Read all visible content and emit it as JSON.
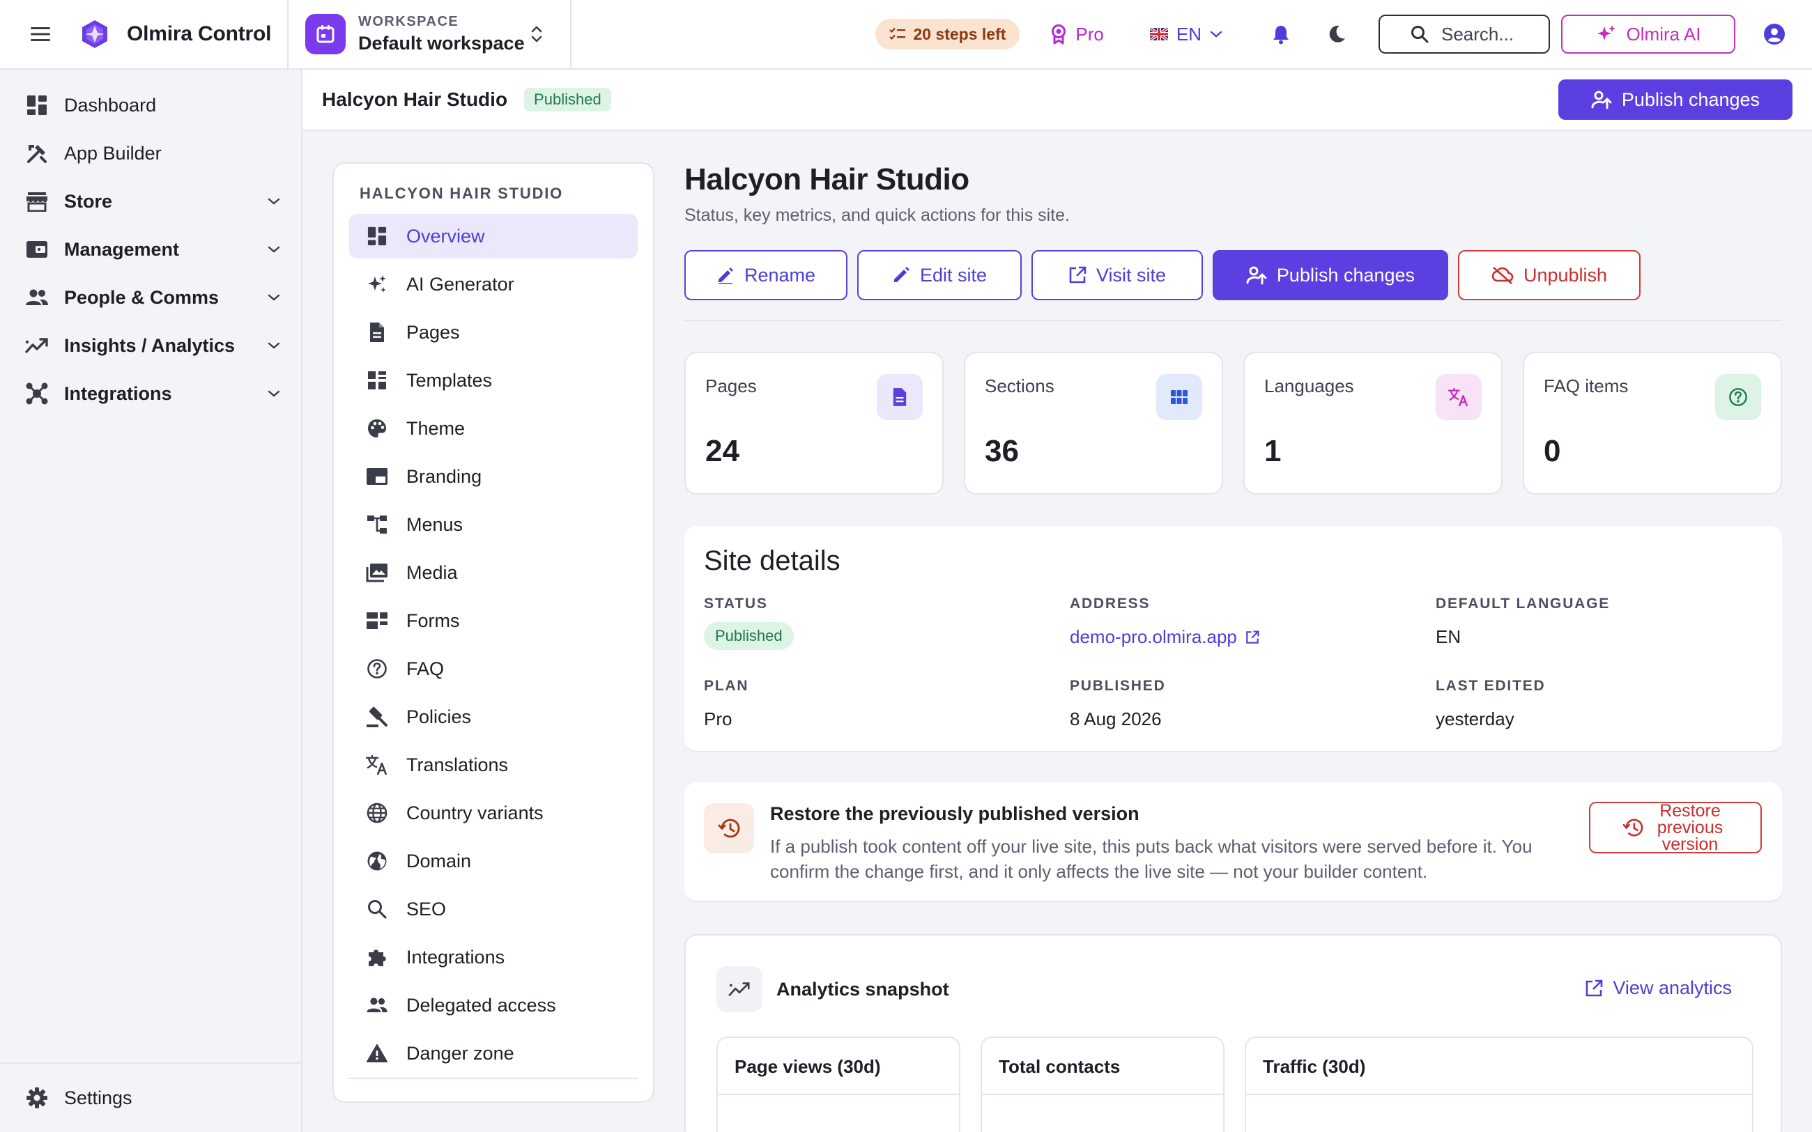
{
  "app": {
    "name": "Olmira Control",
    "workspace_kicker": "WORKSPACE",
    "workspace_name": "Default workspace",
    "steps_left": "20 steps left",
    "plan_label": "Pro",
    "language": "EN",
    "search_placeholder": "Search...",
    "ai_label": "Olmira AI"
  },
  "sidebar": {
    "items": [
      {
        "label": "Dashboard",
        "icon": "dashboard-icon"
      },
      {
        "label": "App Builder",
        "icon": "build-icon"
      },
      {
        "label": "Store",
        "icon": "store-icon"
      },
      {
        "label": "Management",
        "icon": "wallet-icon"
      },
      {
        "label": "People & Comms",
        "icon": "people-icon"
      },
      {
        "label": "Insights / Analytics",
        "icon": "trend-icon"
      },
      {
        "label": "Integrations",
        "icon": "hub-icon"
      }
    ],
    "settings_label": "Settings"
  },
  "header": {
    "site_name": "Halcyon Hair Studio",
    "status_badge": "Published",
    "publish_label": "Publish changes"
  },
  "subnav": {
    "kicker": "HALCYON HAIR STUDIO",
    "items": [
      {
        "label": "Overview"
      },
      {
        "label": "AI Generator"
      },
      {
        "label": "Pages"
      },
      {
        "label": "Templates"
      },
      {
        "label": "Theme"
      },
      {
        "label": "Branding"
      },
      {
        "label": "Menus"
      },
      {
        "label": "Media"
      },
      {
        "label": "Forms"
      },
      {
        "label": "FAQ"
      },
      {
        "label": "Policies"
      },
      {
        "label": "Translations"
      },
      {
        "label": "Country variants"
      },
      {
        "label": "Domain"
      },
      {
        "label": "SEO"
      },
      {
        "label": "Integrations"
      },
      {
        "label": "Delegated access"
      },
      {
        "label": "Danger zone"
      }
    ]
  },
  "main": {
    "title": "Halcyon Hair Studio",
    "subtitle": "Status, key metrics, and quick actions for this site.",
    "actions": {
      "rename": "Rename",
      "edit": "Edit site",
      "visit": "Visit site",
      "publish": "Publish changes",
      "unpublish": "Unpublish"
    },
    "stats": [
      {
        "label": "Pages",
        "value": "24"
      },
      {
        "label": "Sections",
        "value": "36"
      },
      {
        "label": "Languages",
        "value": "1"
      },
      {
        "label": "FAQ items",
        "value": "0"
      }
    ],
    "details": {
      "title": "Site details",
      "status_label": "STATUS",
      "status_value": "Published",
      "address_label": "ADDRESS",
      "address_value": "demo-pro.olmira.app",
      "language_label": "DEFAULT LANGUAGE",
      "language_value": "EN",
      "plan_label": "PLAN",
      "plan_value": "Pro",
      "published_label": "PUBLISHED",
      "published_value": "8 Aug 2026",
      "edited_label": "LAST EDITED",
      "edited_value": "yesterday"
    },
    "restore": {
      "title": "Restore the previously published version",
      "text": "If a publish took content off your live site, this puts back what visitors were served before it. You confirm the change first, and it only affects the live site — not your builder content.",
      "button": "Restore previous version"
    },
    "analytics": {
      "title": "Analytics snapshot",
      "link": "View analytics",
      "cards": [
        "Page views (30d)",
        "Total contacts",
        "Traffic (30d)"
      ]
    }
  },
  "colors": {
    "accent": "#5b3fe0",
    "danger": "#c92e2e",
    "success_bg": "#dcf3e6",
    "success_fg": "#1f7a4c"
  }
}
